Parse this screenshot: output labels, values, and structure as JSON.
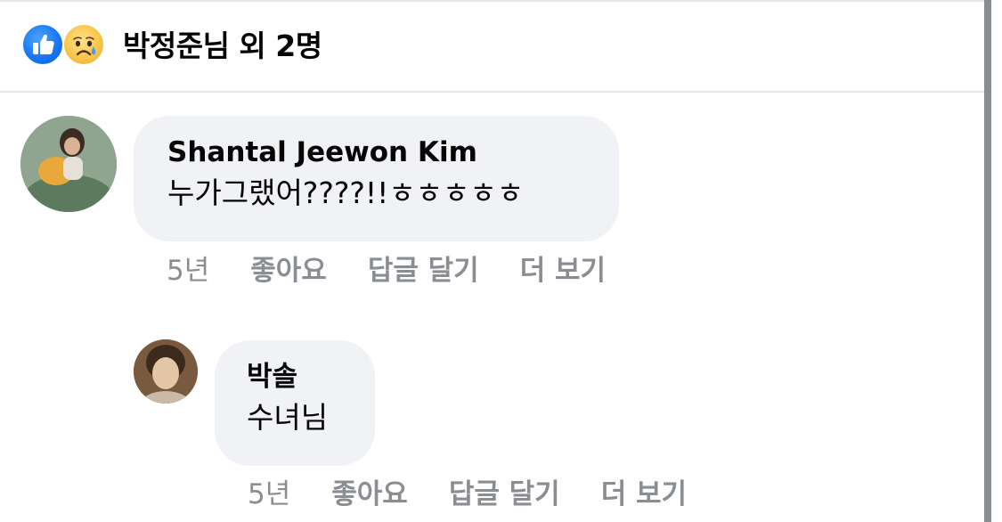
{
  "reactions": {
    "summary": "박정준님 외 2명",
    "icons": [
      "like-icon",
      "sad-face-icon"
    ],
    "like_color": "#1877f2",
    "sad_color": "#f7c64a"
  },
  "comments": [
    {
      "author": "Shantal Jeewon Kim",
      "text": "누가그랬어????!!ㅎㅎㅎㅎㅎ",
      "actions": {
        "time": "5년",
        "like": "좋아요",
        "reply": "답글 달기",
        "more": "더 보기"
      }
    },
    {
      "author": "박솔",
      "text": "수녀님",
      "actions": {
        "time": "5년",
        "like": "좋아요",
        "reply": "답글 달기",
        "more": "더 보기"
      }
    }
  ],
  "colors": {
    "bubble": "#f0f2f5",
    "meta_text": "#8a8d91",
    "text": "#050505"
  }
}
